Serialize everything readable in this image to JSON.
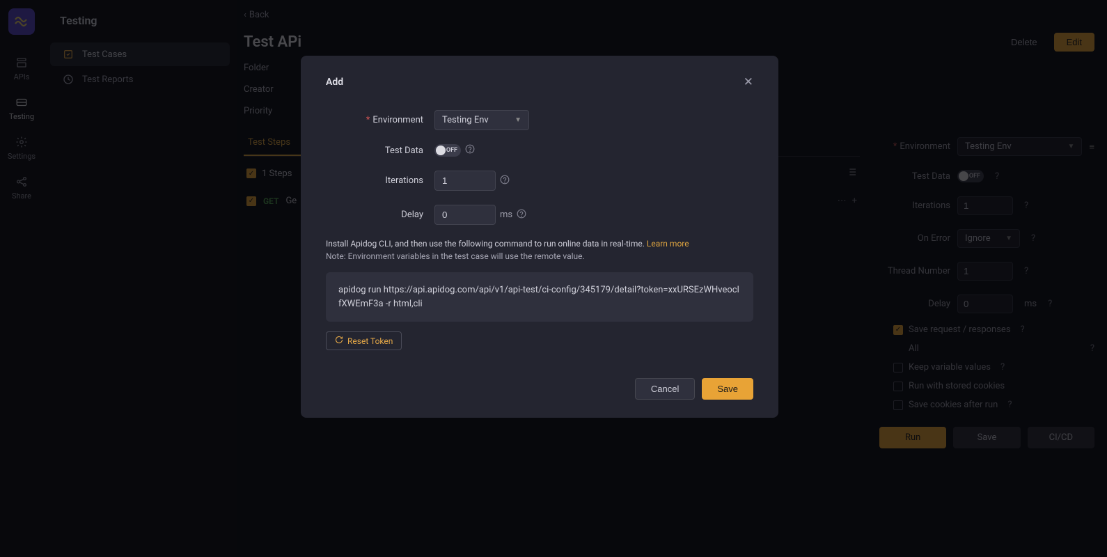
{
  "rail": {
    "items": [
      {
        "label": "APIs"
      },
      {
        "label": "Testing"
      },
      {
        "label": "Settings"
      },
      {
        "label": "Share"
      }
    ]
  },
  "sidebar": {
    "title": "Testing",
    "items": [
      {
        "label": "Test Cases"
      },
      {
        "label": "Test Reports"
      }
    ]
  },
  "main": {
    "back": "Back",
    "title": "Test APi",
    "btn_delete": "Delete",
    "btn_edit": "Edit",
    "info": {
      "folder": "Folder",
      "creator": "Creator",
      "priority": "Priority"
    },
    "tab_steps": "Test Steps",
    "steps_count": "1 Steps",
    "step": {
      "method": "GET",
      "title": "Ge"
    }
  },
  "rpanel": {
    "env_label": "Environment",
    "env_value": "Testing Env",
    "test_data_label": "Test Data",
    "toggle_off": "OFF",
    "iterations_label": "Iterations",
    "iterations_value": "1",
    "on_error_label": "On Error",
    "on_error_value": "Ignore",
    "thread_label": "Thread Number",
    "thread_value": "1",
    "delay_label": "Delay",
    "delay_value": "0",
    "delay_unit": "ms",
    "save_req": "Save request / responses",
    "all": "All",
    "keep_var": "Keep variable values",
    "run_cookies": "Run with stored cookies",
    "save_cookies": "Save cookies after run",
    "btn_run": "Run",
    "btn_save": "Save",
    "btn_cicd": "CI/CD"
  },
  "modal": {
    "title": "Add",
    "env_label": "Environment",
    "env_value": "Testing Env",
    "test_data_label": "Test Data",
    "toggle_off": "OFF",
    "iterations_label": "Iterations",
    "iterations_value": "1",
    "delay_label": "Delay",
    "delay_value": "0",
    "delay_unit": "ms",
    "cli_text": "Install Apidog CLI, and then use the following command to run online data in real-time. ",
    "learn_more": "Learn more",
    "note": "Note: Environment variables in the test case will use the remote value.",
    "code": "apidog run https://api.apidog.com/api/v1/api-test/ci-config/345179/detail?token=xxURSEzWHveoclfXWEmF3a -r html,cli",
    "reset_token": "Reset Token",
    "cancel": "Cancel",
    "save": "Save"
  }
}
